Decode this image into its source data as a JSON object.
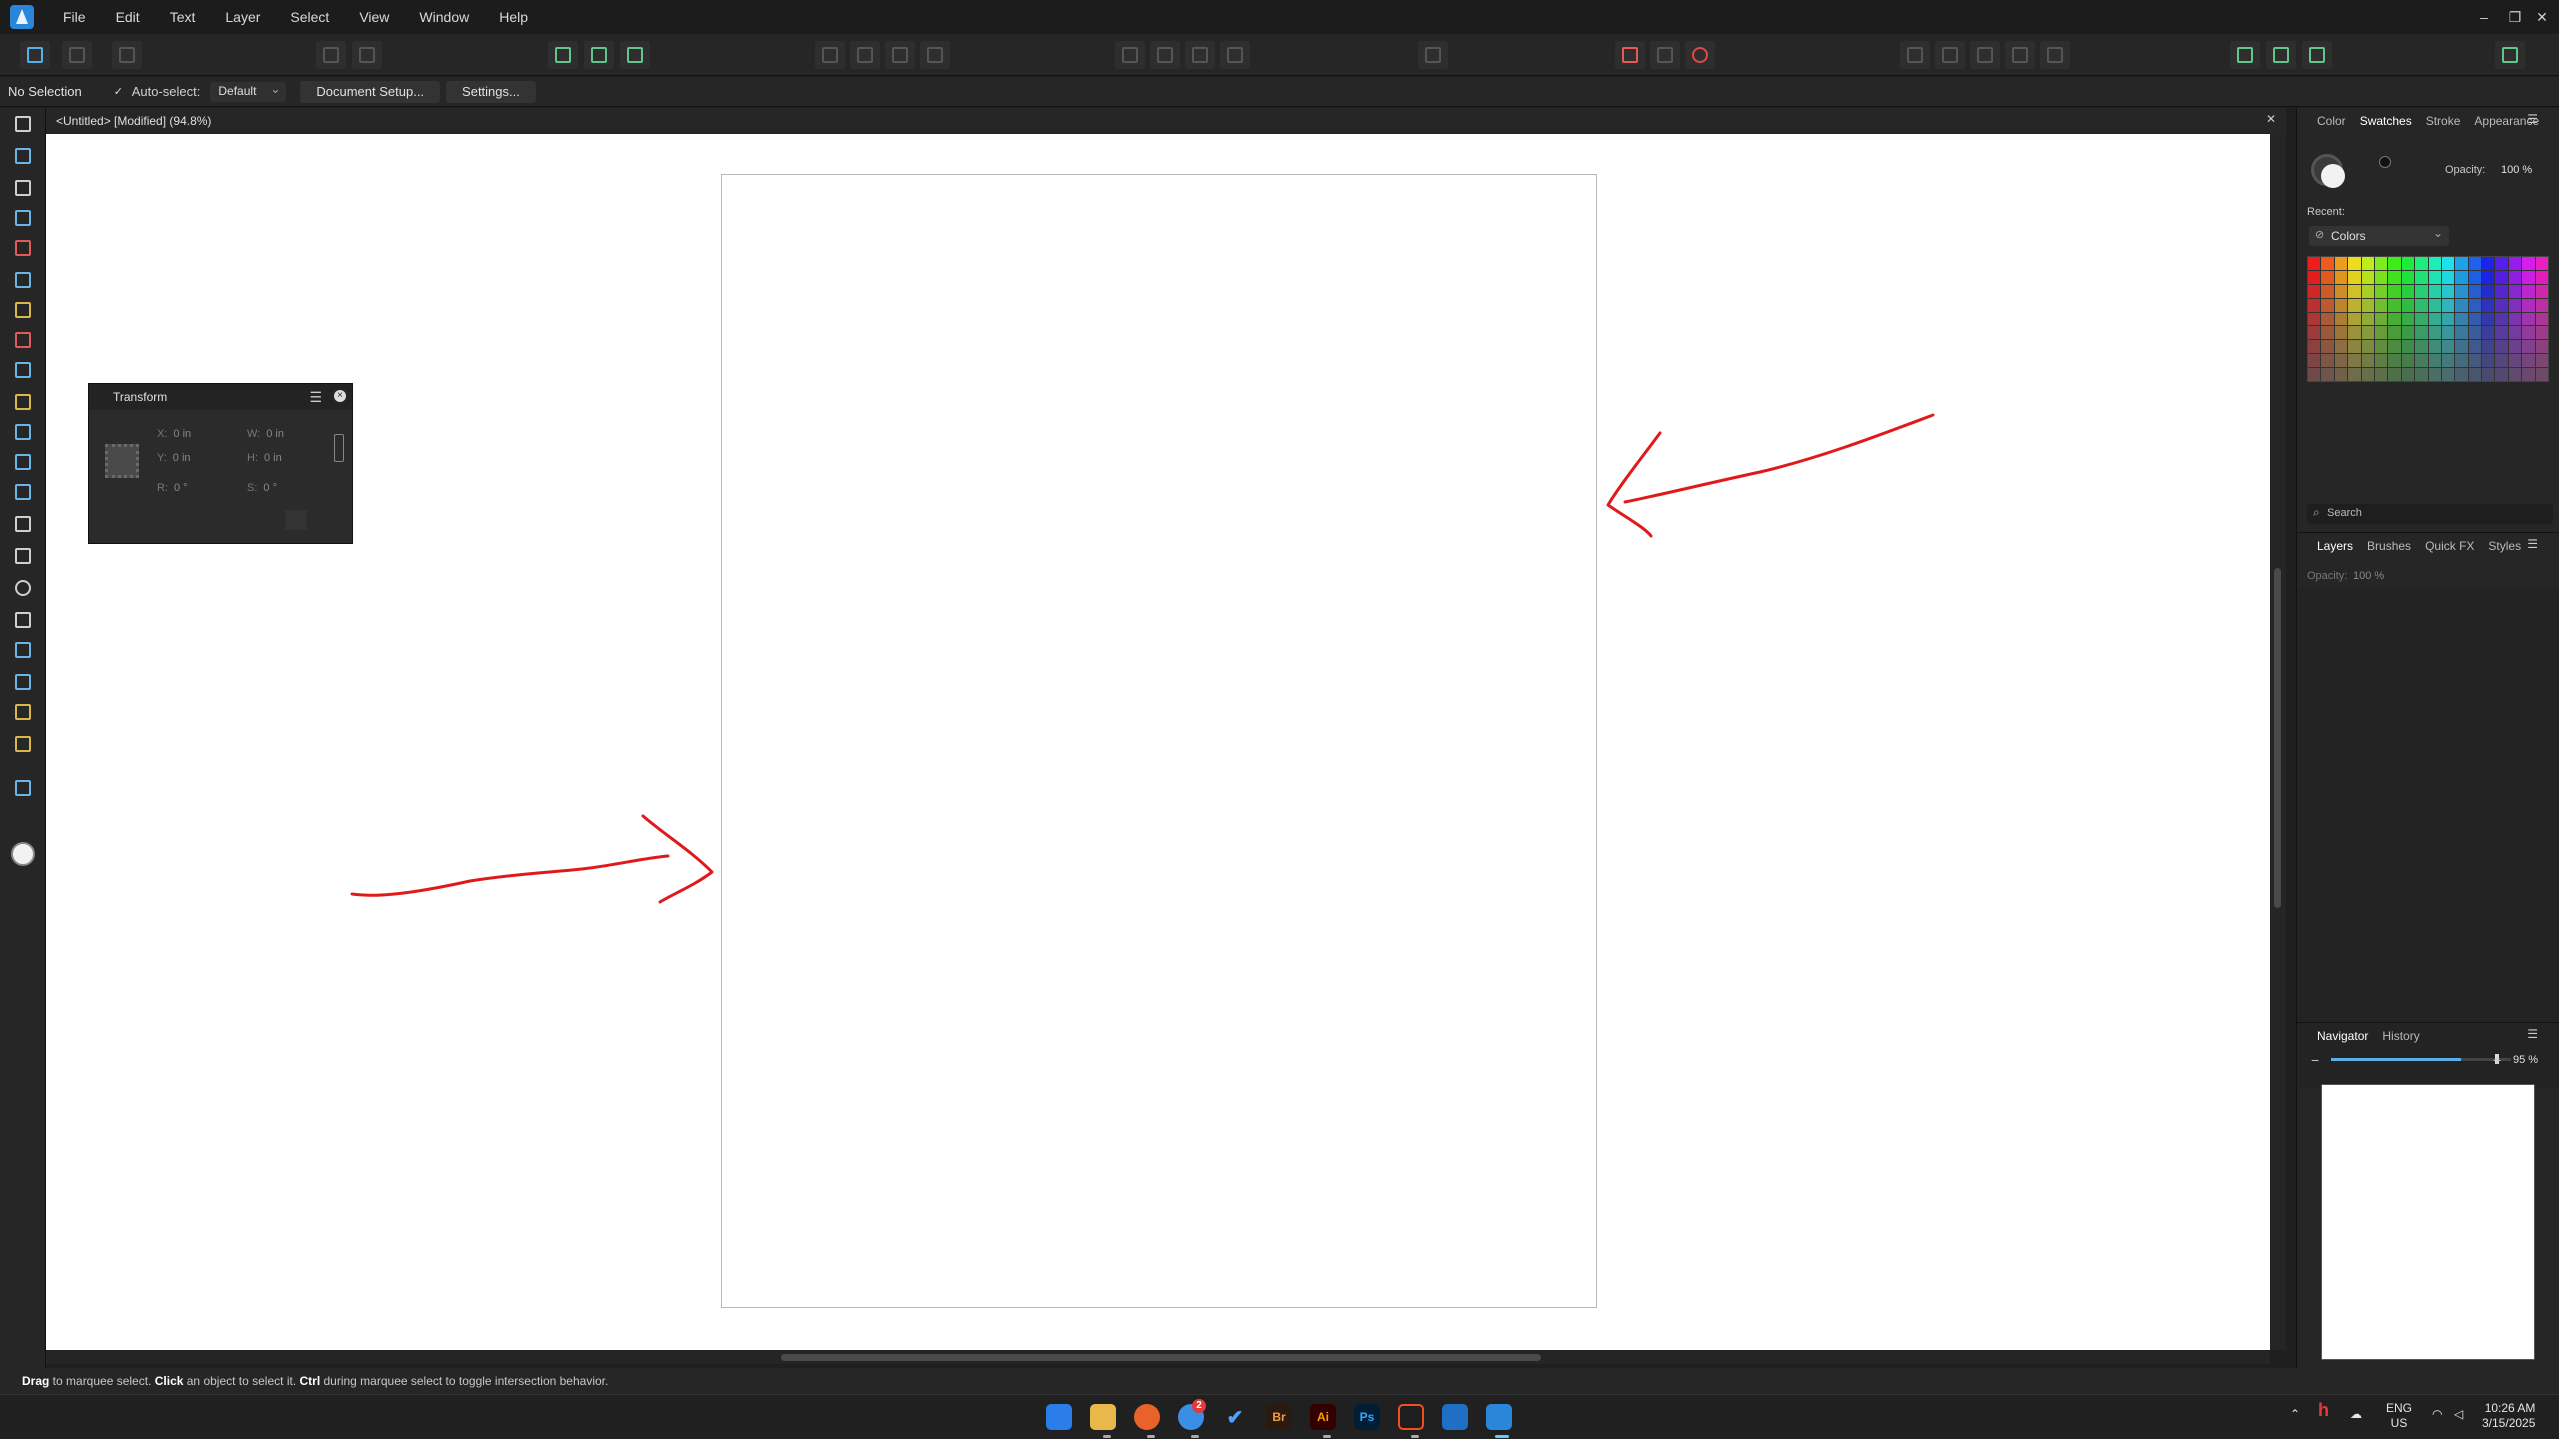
{
  "app": {
    "menu": [
      "File",
      "Edit",
      "Text",
      "Layer",
      "Select",
      "View",
      "Window",
      "Help"
    ],
    "window_controls": {
      "minimize": "–",
      "restore": "❐",
      "close": "✕"
    }
  },
  "context_bar": {
    "selection_status": "No Selection",
    "auto_select_label": "Auto-select:",
    "auto_select_value": "Default",
    "document_setup_label": "Document Setup...",
    "settings_label": "Settings..."
  },
  "document": {
    "tab_title": "<Untitled> [Modified] (94.8%)",
    "close_glyph": "✕"
  },
  "transform_panel": {
    "title": "Transform",
    "x_label": "X:",
    "x_value": "0 in",
    "y_label": "Y:",
    "y_value": "0 in",
    "w_label": "W:",
    "w_value": "0 in",
    "h_label": "H:",
    "h_value": "0 in",
    "r_label": "R:",
    "r_value": "0 °",
    "s_label": "S:",
    "s_value": "0 °",
    "menu_glyph": "☰",
    "close_glyph": "×"
  },
  "color_panel": {
    "tabs": [
      "Color",
      "Swatches",
      "Stroke",
      "Appearance"
    ],
    "active_tab": "Swatches",
    "opacity_label": "Opacity:",
    "opacity_value": "100 %",
    "recent_label": "Recent:",
    "palette_name": "Colors",
    "search_placeholder": "Search"
  },
  "layers_panel": {
    "tabs": [
      "Layers",
      "Brushes",
      "Quick FX",
      "Styles"
    ],
    "active_tab": "Layers",
    "opacity_label": "Opacity:",
    "opacity_value": "100 %"
  },
  "navigator_panel": {
    "tabs": [
      "Navigator",
      "History"
    ],
    "active_tab": "Navigator",
    "zoom_value": "95 %",
    "zoom_fraction": 0.72
  },
  "status_bar": {
    "w1": "Drag",
    "t1": " to marquee select. ",
    "w2": "Click",
    "t2": " an object to select it. ",
    "w3": "Ctrl",
    "t3": " during marquee select to toggle intersection behavior."
  },
  "taskbar": {
    "apps": [
      {
        "label": "Br",
        "bg": "#2a1a10",
        "fg": "#f0a040"
      },
      {
        "label": "Ai",
        "bg": "#330000",
        "fg": "#ff9a00"
      },
      {
        "label": "Ps",
        "bg": "#001e36",
        "fg": "#31a8ff"
      }
    ],
    "notification_badge": "2",
    "lang_line1": "ENG",
    "lang_line2": "US",
    "time": "10:26 AM",
    "date": "3/15/2025"
  },
  "colors": {
    "accent": "#2a86d8",
    "annotation_red": "#e01a1a"
  }
}
